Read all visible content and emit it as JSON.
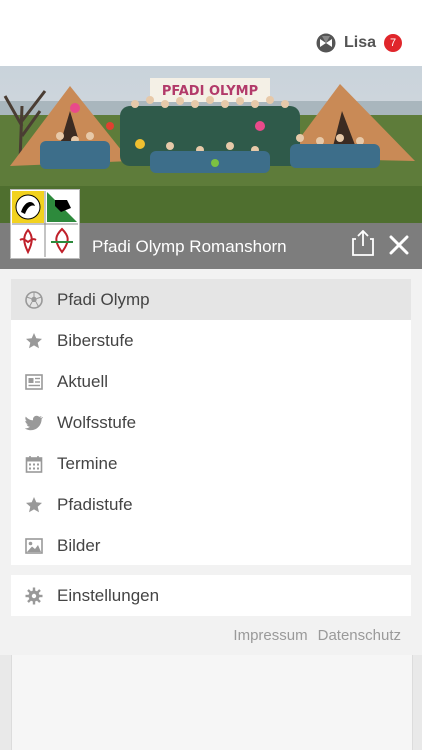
{
  "user": {
    "name": "Lisa",
    "notifications": "7",
    "icon": "app-logo-icon"
  },
  "hero": {
    "banner_text": "PFADI OLYMP"
  },
  "header": {
    "title": "Pfadi Olymp Romanshorn",
    "share_icon": "share-icon",
    "close_icon": "close-icon"
  },
  "menu": {
    "items": [
      {
        "label": "Pfadi Olymp",
        "icon": "soccer-ball-icon",
        "active": true
      },
      {
        "label": "Biberstufe",
        "icon": "star-icon"
      },
      {
        "label": "Aktuell",
        "icon": "newspaper-icon"
      },
      {
        "label": "Wolfsstufe",
        "icon": "twitter-bird-icon"
      },
      {
        "label": "Termine",
        "icon": "calendar-icon"
      },
      {
        "label": "Pfadistufe",
        "icon": "star-icon"
      },
      {
        "label": "Bilder",
        "icon": "image-icon"
      }
    ]
  },
  "settings": {
    "label": "Einstellungen",
    "icon": "gear-icon"
  },
  "footer": {
    "impressum": "Impressum",
    "datenschutz": "Datenschutz"
  },
  "colors": {
    "badge": "#e0262b",
    "header_strip": "#7d7d7d",
    "active_item": "#e5e5e5"
  }
}
